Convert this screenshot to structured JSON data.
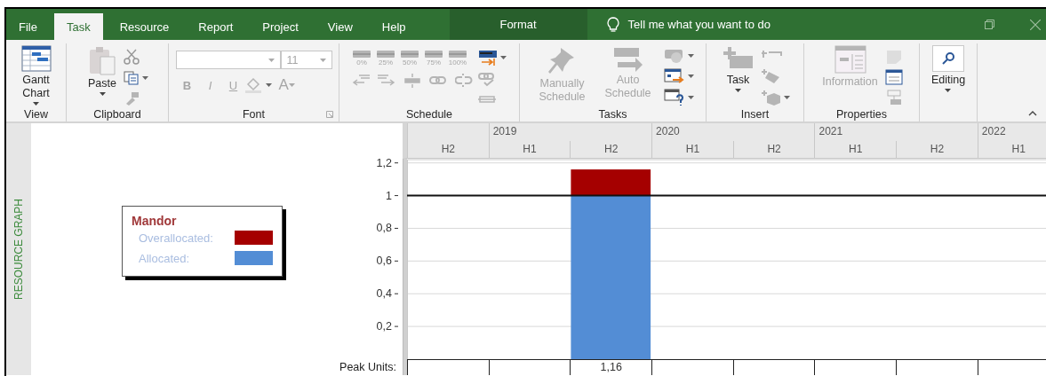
{
  "tabs": [
    {
      "label": "File",
      "selected": false,
      "kind": "standard"
    },
    {
      "label": "Task",
      "selected": true,
      "kind": "standard"
    },
    {
      "label": "Resource",
      "selected": false,
      "kind": "standard"
    },
    {
      "label": "Report",
      "selected": false,
      "kind": "standard"
    },
    {
      "label": "Project",
      "selected": false,
      "kind": "standard"
    },
    {
      "label": "View",
      "selected": false,
      "kind": "standard"
    },
    {
      "label": "Help",
      "selected": false,
      "kind": "standard"
    },
    {
      "label": "Format",
      "selected": false,
      "kind": "contextual"
    }
  ],
  "tell_me": {
    "placeholder": "Tell me what you want to do"
  },
  "ribbon": {
    "groups": [
      {
        "label": "View",
        "items": [
          {
            "kind": "large",
            "label": "Gantt Chart",
            "dropdown": true,
            "disabled": false
          }
        ]
      },
      {
        "label": "Clipboard",
        "items": [
          {
            "kind": "large",
            "label": "Paste",
            "dropdown": true,
            "disabled": false
          }
        ]
      },
      {
        "label": "Font",
        "items": [
          {
            "kind": "font",
            "size": "11",
            "styles": [
              "B",
              "I",
              "U"
            ],
            "color_letter": "A",
            "disabled": true
          }
        ]
      },
      {
        "label": "Schedule",
        "items": [
          {
            "kind": "percent",
            "labels": [
              "0%",
              "25%",
              "50%",
              "75%",
              "100%"
            ],
            "disabled": true
          }
        ]
      },
      {
        "label": "Tasks",
        "items": [
          {
            "kind": "large",
            "label": "Manually Schedule",
            "dropdown": false,
            "disabled": true
          },
          {
            "kind": "large",
            "label": "Auto Schedule",
            "dropdown": false,
            "disabled": true
          }
        ]
      },
      {
        "label": "Insert",
        "items": [
          {
            "kind": "large",
            "label": "Task",
            "dropdown": true,
            "disabled": false
          }
        ]
      },
      {
        "label": "Properties",
        "items": [
          {
            "kind": "large",
            "label": "Information",
            "dropdown": false,
            "disabled": true
          }
        ]
      },
      {
        "items": [
          {
            "kind": "large",
            "label": "Editing",
            "dropdown": true,
            "disabled": false
          }
        ]
      }
    ]
  },
  "side_label": "RESOURCE GRAPH",
  "legend": {
    "title": "Mandor"
  },
  "timescale": {
    "years": [
      "2019",
      "2020",
      "2021",
      "2022"
    ]
  },
  "chart_data": {
    "type": "bar",
    "stacked": true,
    "grid": true,
    "categories": [
      "H2",
      "H1",
      "H2",
      "H1",
      "H2",
      "H1",
      "H2",
      "H1"
    ],
    "series": [
      {
        "name": "Allocated:",
        "color": "#538dd5",
        "values": [
          null,
          null,
          1,
          null,
          null,
          null,
          null,
          null
        ]
      },
      {
        "name": "Overallocated:",
        "color": "#a50000",
        "values": [
          null,
          null,
          0.16,
          null,
          null,
          null,
          null,
          null
        ]
      }
    ],
    "value_labels": [
      null,
      null,
      "1,16",
      null,
      null,
      null,
      null,
      null
    ],
    "ylim": [
      0,
      1.22
    ],
    "yticks": [
      {
        "value": 0.2,
        "label": "0,2"
      },
      {
        "value": 0.4,
        "label": "0,4"
      },
      {
        "value": 0.6,
        "label": "0,6"
      },
      {
        "value": 0.8,
        "label": "0,8"
      },
      {
        "value": 1,
        "label": "1"
      },
      {
        "value": 1.2,
        "label": "1,2"
      }
    ],
    "ref_lines": [
      {
        "axis": "y",
        "value": 1
      }
    ]
  },
  "peak_units": {
    "label": "Peak Units:"
  }
}
